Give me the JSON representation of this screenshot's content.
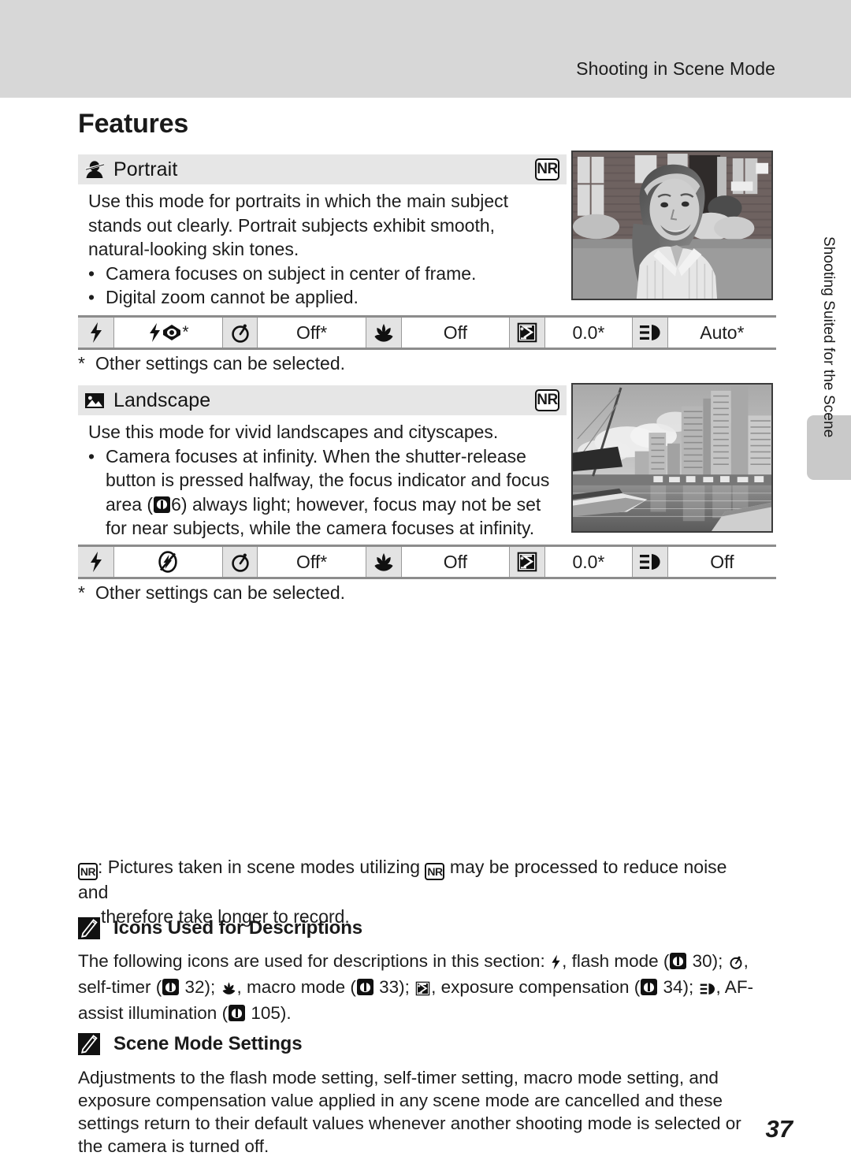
{
  "header": {
    "running_title": "Shooting in Scene Mode"
  },
  "page_title": "Features",
  "side_tab": {
    "label": "Shooting Suited for the Scene"
  },
  "page_number": "37",
  "modes": [
    {
      "id": "portrait",
      "icon_name": "portrait-mode-icon",
      "label": "Portrait",
      "badge": "NR",
      "description": "Use this mode for portraits in which the main subject stands out clearly. Portrait subjects exhibit smooth, natural-looking skin tones.",
      "bullets": [
        "Camera focuses on subject in center of frame.",
        "Digital zoom cannot be applied."
      ],
      "photo_name": "portrait-sample-photo",
      "settings": [
        {
          "icon": "flash-mode-icon",
          "value": "",
          "value_icon": "flash-auto-red-eye-icon",
          "value_suffix": "*"
        },
        {
          "icon": "self-timer-icon",
          "value": "Off*"
        },
        {
          "icon": "macro-mode-icon",
          "value": "Off"
        },
        {
          "icon": "exposure-compensation-icon",
          "value": "0.0*"
        },
        {
          "icon": "af-assist-icon",
          "value": "Auto*"
        }
      ],
      "footnote": "Other settings can be selected.",
      "footnote_marker": "*"
    },
    {
      "id": "landscape",
      "icon_name": "landscape-mode-icon",
      "label": "Landscape",
      "badge": "NR",
      "description": "Use this mode for vivid landscapes and cityscapes.",
      "bullets": [
        "Camera focuses at infinity. When the shutter-release button is pressed halfway, the focus indicator and focus area ( 6) always light; however, focus may not be set for near subjects, while the camera focuses at infinity."
      ],
      "bullet_ref_page": "6",
      "photo_name": "landscape-sample-photo",
      "settings": [
        {
          "icon": "flash-mode-icon",
          "value": "",
          "value_icon": "flash-off-icon",
          "value_suffix": ""
        },
        {
          "icon": "self-timer-icon",
          "value": "Off*"
        },
        {
          "icon": "macro-mode-icon",
          "value": "Off"
        },
        {
          "icon": "exposure-compensation-icon",
          "value": "0.0*"
        },
        {
          "icon": "af-assist-icon",
          "value": "Off"
        }
      ],
      "footnote": "Other settings can be selected.",
      "footnote_marker": "*"
    }
  ],
  "nr_note": {
    "badge": "NR",
    "text_part1": ": Pictures taken in scene modes utilizing ",
    "badge_inline": "NR",
    "text_part2": " may be processed to reduce noise and",
    "text_line2": "therefore take longer to record."
  },
  "tips": [
    {
      "id": "icons-used",
      "icon_name": "pencil-note-icon",
      "title": "Icons Used for Descriptions",
      "body_segments": [
        "The following icons are used for descriptions in this section: ",
        ", flash mode (",
        " 30); ",
        ", self-timer (",
        " 32); ",
        ", macro mode (",
        " 33); ",
        ", exposure compensation (",
        " 34); ",
        ", AF-assist illumination (",
        " 105)."
      ],
      "ref_pages": [
        "30",
        "32",
        "33",
        "34",
        "105"
      ]
    },
    {
      "id": "scene-mode-settings",
      "icon_name": "pencil-note-icon",
      "title": "Scene Mode Settings",
      "body": "Adjustments to the flash mode setting, self-timer setting, macro mode setting, and exposure compensation value applied in any scene mode are cancelled and these settings return to their default values whenever another shooting mode is selected or the camera is turned off."
    }
  ],
  "colors": {
    "header_band": "#d7d7d7",
    "mode_head": "#e6e6e6",
    "table_icon_cell": "#e3e3e3",
    "side_tab": "#c9c9c9",
    "text": "#1d1d1d"
  }
}
